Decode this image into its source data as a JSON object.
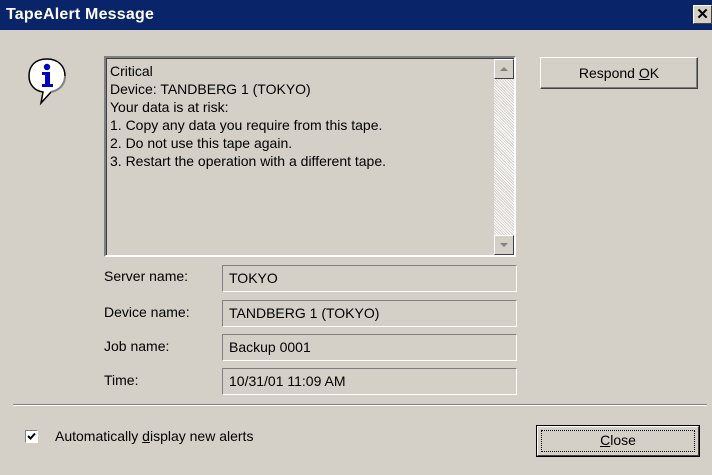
{
  "window": {
    "title": "TapeAlert Message",
    "close_glyph": "✕"
  },
  "message": {
    "lines": [
      "Critical",
      "Device: TANDBERG 1 (TOKYO)",
      "Your data is at risk:",
      "1. Copy any data you require from this tape.",
      "2. Do not use this tape again.",
      "3. Restart the operation with a different tape."
    ]
  },
  "icons": {
    "info": "info-icon",
    "scroll_up": "scroll-up-arrow-icon",
    "scroll_down": "scroll-down-arrow-icon",
    "checkmark": "checkmark-icon"
  },
  "buttons": {
    "respond_prefix": "Respond ",
    "respond_mnemonic": "O",
    "respond_suffix": "K",
    "close_mnemonic": "C",
    "close_suffix": "lose"
  },
  "fields": {
    "server": {
      "label": "Server name:",
      "value": "TOKYO"
    },
    "device": {
      "label": "Device name:",
      "value": "TANDBERG 1 (TOKYO)"
    },
    "job": {
      "label": "Job name:",
      "value": "Backup 0001"
    },
    "time": {
      "label": "Time:",
      "value": "10/31/01 11:09 AM"
    }
  },
  "auto_display": {
    "checked": true,
    "label_prefix": "Automatically ",
    "label_mnemonic": "d",
    "label_suffix": "isplay new alerts"
  },
  "colors": {
    "titlebar": "#0a246a",
    "face": "#d4d0c8",
    "icon_blue": "#0000c0"
  }
}
